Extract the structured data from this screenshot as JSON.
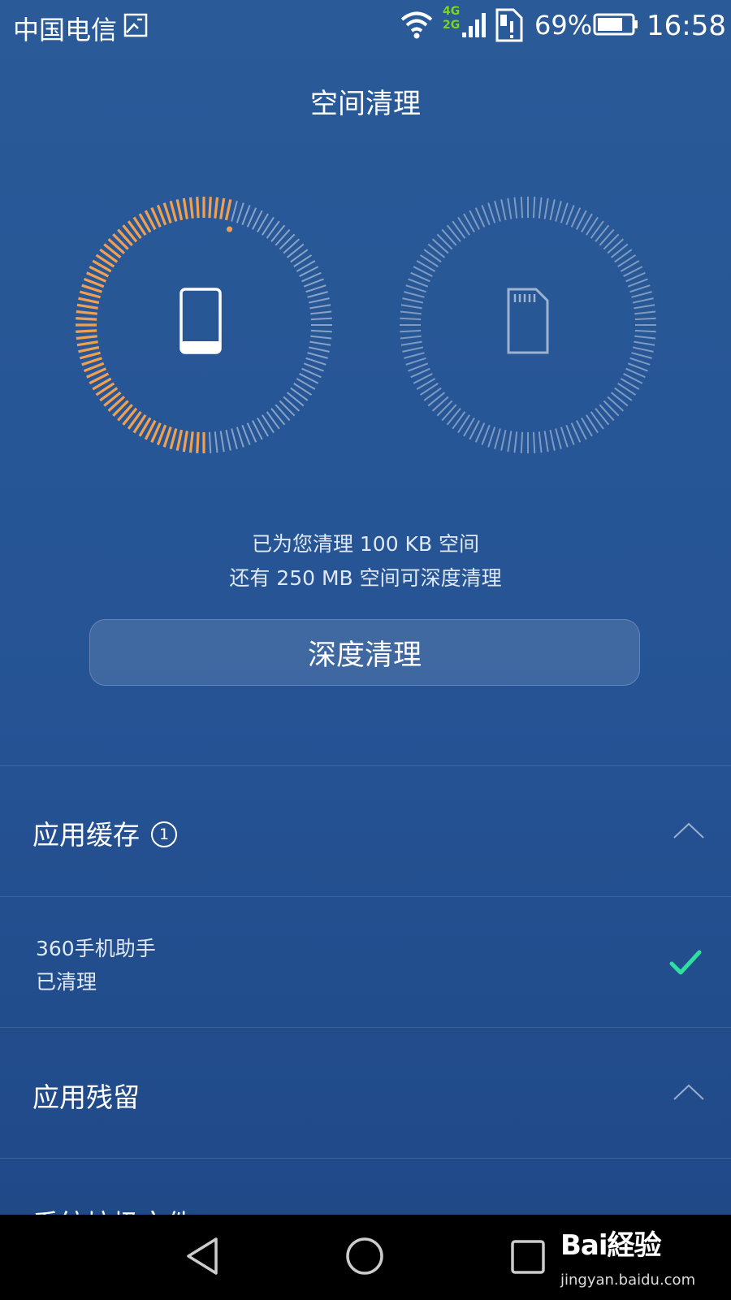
{
  "status_bar": {
    "carrier": "中国电信",
    "network_4g": "4G",
    "network_2g": "2G",
    "battery_percent": "69%",
    "time": "16:58",
    "icons": [
      "gallery-icon",
      "wifi-icon",
      "signal-icon",
      "sim-alert-icon",
      "battery-icon"
    ]
  },
  "header": {
    "title": "空间清理"
  },
  "storage": {
    "phone": {
      "icon": "phone-icon",
      "used_fraction": 0.54,
      "active_color": "#f0a050"
    },
    "sd_card": {
      "icon": "sd-card-icon",
      "used_fraction": 0.0
    }
  },
  "summary": {
    "line1": "已为您清理 100 KB 空间",
    "line2": "还有 250 MB 空间可深度清理"
  },
  "deep_clean": {
    "label": "深度清理"
  },
  "sections": {
    "app_cache": {
      "title": "应用缓存",
      "count": "1",
      "expanded": true,
      "items": [
        {
          "name": "360手机助手",
          "status": "已清理",
          "checked": true
        }
      ]
    },
    "app_residue": {
      "title": "应用残留",
      "expanded": true
    },
    "next_section": {
      "title": "系统垃圾文件"
    }
  },
  "colors": {
    "accent_orange": "#f0a050",
    "check_green": "#2ee0a0"
  },
  "nav_bar": {
    "icons": [
      "back-icon",
      "home-icon",
      "recent-apps-icon"
    ]
  },
  "watermark": {
    "logo": "Bai経验",
    "url": "jingyan.baidu.com"
  }
}
